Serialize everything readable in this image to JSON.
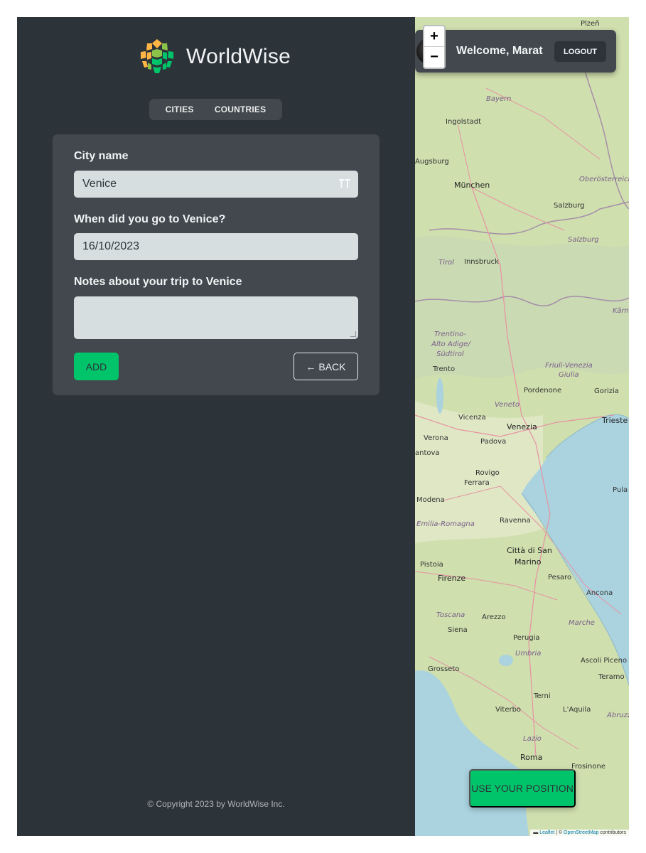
{
  "app": {
    "name": "WorldWise"
  },
  "nav": {
    "cities": "CITIES",
    "countries": "COUNTRIES"
  },
  "form": {
    "city_label": "City name",
    "city_value": "Venice",
    "date_label": "When did you go to Venice?",
    "date_value": "16/10/2023",
    "notes_label": "Notes about your trip to Venice",
    "notes_value": "",
    "add_label": "ADD",
    "back_label": "← BACK"
  },
  "footer": {
    "copyright": "© Copyright 2023 by WorldWise Inc."
  },
  "user": {
    "welcome": "Welcome, Marat",
    "logout": "LOGOUT"
  },
  "map": {
    "zoom_in": "+",
    "zoom_out": "−",
    "use_position": "USE YOUR POSITION",
    "attribution_leaflet": "Leaflet",
    "attribution_mid": " | © ",
    "attribution_osm": "OpenStreetMap",
    "attribution_end": " contributors",
    "labels": {
      "plzen": "Plzeň",
      "bayern": "Bayern",
      "ingolstadt": "Ingolstadt",
      "augsburg": "Augsburg",
      "munchen": "München",
      "oberosterreich": "Oberösterreich",
      "salzburg_city": "Salzburg",
      "salzburg_region": "Salzburg",
      "tirol": "Tirol",
      "innsbruck": "Innsbruck",
      "karnten": "Kärn",
      "trentino": "Trentino-",
      "alto_adige": "Alto Adige/",
      "sudtirol": "Südtirol",
      "friuli": "Friuli-Venezia",
      "giulia": "Giulia",
      "trento": "Trento",
      "pordenone": "Pordenone",
      "gorizia": "Gorizia",
      "veneto": "Veneto",
      "vicenza": "Vicenza",
      "venezia": "Venezia",
      "trieste": "Trieste",
      "verona": "Verona",
      "padova": "Padova",
      "mantova": "antova",
      "rovigo": "Rovigo",
      "ferrara": "Ferrara",
      "pula": "Pula",
      "modena": "Modena",
      "emilia": "Emilia-Romagna",
      "ravenna": "Ravenna",
      "san_marino": "Città di San",
      "marino": "Marino",
      "pistoia": "Pistoia",
      "firenze": "Firenze",
      "pesaro": "Pesaro",
      "ancona": "Ancona",
      "toscana": "Toscana",
      "arezzo": "Arezzo",
      "marche": "Marche",
      "siena": "Siena",
      "perugia": "Perugia",
      "umbria": "Umbria",
      "grosseto": "Grosseto",
      "ascoli": "Ascoli Piceno",
      "teramo": "Teramo",
      "terni": "Terni",
      "viterbo": "Viterbo",
      "laquila": "L'Aquila",
      "abruzzo": "Abruzz",
      "lazio": "Lazio",
      "roma": "Roma",
      "frosinone": "Frosinone"
    }
  },
  "colors": {
    "sidebar_bg": "#2d3439",
    "panel_bg": "#42484d",
    "brand_green": "#00c46a",
    "input_bg": "#d6dee0",
    "sea": "#aad3df",
    "land": "#cfdfae"
  }
}
